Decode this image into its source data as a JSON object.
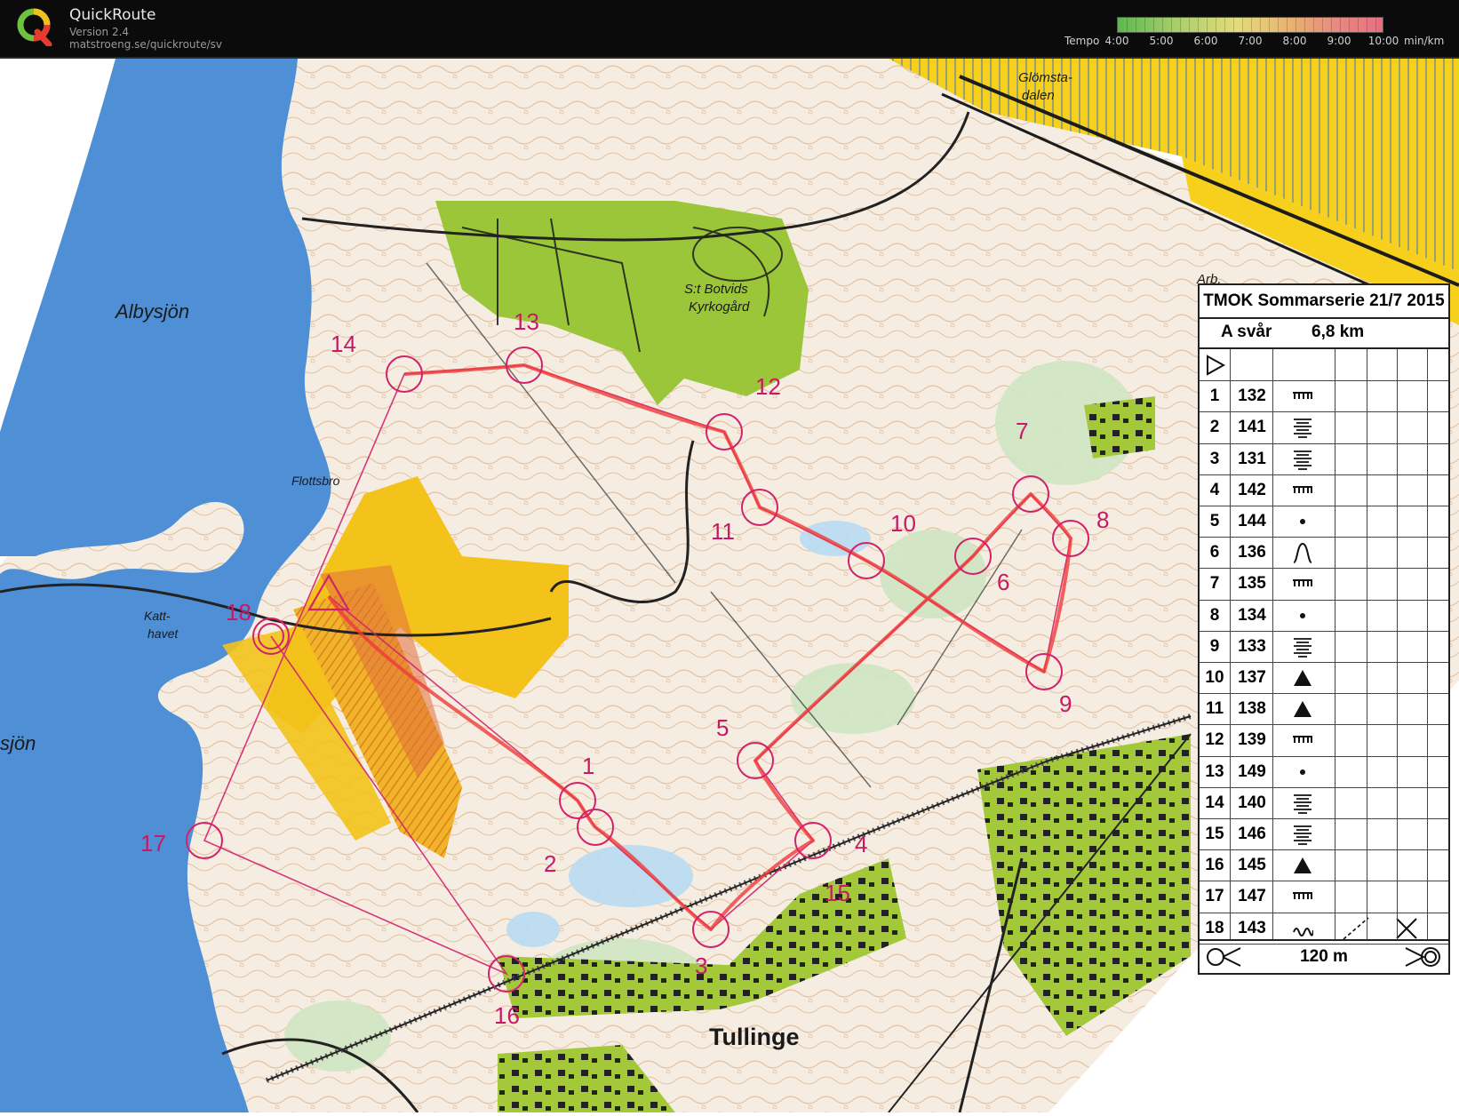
{
  "app": {
    "title": "QuickRoute",
    "version": "Version 2.4",
    "url": "matstroeng.se/quickroute/sv"
  },
  "tempo_scale": {
    "label": "Tempo",
    "values": [
      "4:00",
      "5:00",
      "6:00",
      "7:00",
      "8:00",
      "9:00",
      "10:00"
    ],
    "unit": "min/km",
    "colors": [
      "#5db850",
      "#a8cf6a",
      "#e3dc7a",
      "#eab070",
      "#e88780",
      "#e86f80"
    ]
  },
  "map": {
    "place_names": {
      "albysjon": "Albysjön",
      "sjon": "sjön",
      "glomsta_1": "Glömsta-",
      "glomsta_2": "dalen",
      "arb": "Arb.",
      "kyrkogard_1": "S:t Botvids",
      "kyrkogard_2": "Kyrkogård",
      "flottsbro": "Flottsbro",
      "katthavet_1": "Katt-",
      "katthavet_2": "havet",
      "tullinge": "Tullinge"
    },
    "control_labels": [
      "1",
      "2",
      "3",
      "4",
      "5",
      "6",
      "7",
      "8",
      "9",
      "10",
      "11",
      "12",
      "13",
      "14",
      "15",
      "16",
      "17",
      "18"
    ],
    "colors": {
      "water": "#4e8fd6",
      "open": "#f3c21b",
      "green": "#9bc639",
      "course": "#d2226a",
      "route": "#ef3b3b",
      "contour": "#c77a3c"
    }
  },
  "control_descriptions": {
    "title": "TMOK Sommarserie 21/7 2015",
    "class": "A svår",
    "length": "6,8 km",
    "rows": [
      {
        "num": "1",
        "code": "132",
        "symbol": "wall-ruined"
      },
      {
        "num": "2",
        "code": "141",
        "symbol": "stacked-lines"
      },
      {
        "num": "3",
        "code": "131",
        "symbol": "stacked-lines"
      },
      {
        "num": "4",
        "code": "142",
        "symbol": "wall-ruined"
      },
      {
        "num": "5",
        "code": "144",
        "symbol": "dot"
      },
      {
        "num": "6",
        "code": "136",
        "symbol": "knoll-profile"
      },
      {
        "num": "7",
        "code": "135",
        "symbol": "wall-ruined"
      },
      {
        "num": "8",
        "code": "134",
        "symbol": "dot"
      },
      {
        "num": "9",
        "code": "133",
        "symbol": "stacked-lines"
      },
      {
        "num": "10",
        "code": "137",
        "symbol": "triangle"
      },
      {
        "num": "11",
        "code": "138",
        "symbol": "triangle"
      },
      {
        "num": "12",
        "code": "139",
        "symbol": "wall-ruined"
      },
      {
        "num": "13",
        "code": "149",
        "symbol": "dot"
      },
      {
        "num": "14",
        "code": "140",
        "symbol": "stacked-lines"
      },
      {
        "num": "15",
        "code": "146",
        "symbol": "stacked-lines"
      },
      {
        "num": "16",
        "code": "145",
        "symbol": "triangle"
      },
      {
        "num": "17",
        "code": "147",
        "symbol": "wall-ruined"
      },
      {
        "num": "18",
        "code": "143",
        "symbol": "wavy"
      }
    ],
    "finish_distance": "120 m"
  }
}
